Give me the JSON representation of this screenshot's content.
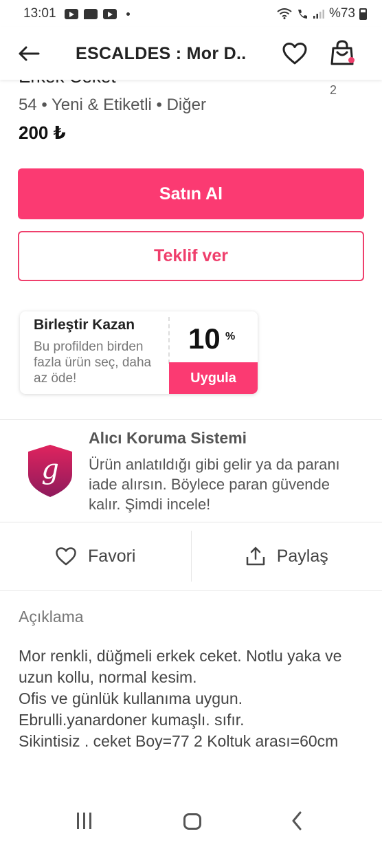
{
  "status_bar": {
    "time": "13:01",
    "battery": "%73"
  },
  "app_bar": {
    "title": "ESCALDES : Mor D..",
    "icons": [
      "arrow-left-icon",
      "heart-icon",
      "shopping-bag-icon"
    ]
  },
  "product": {
    "title": "Erkek Ceket",
    "photo_count": "2",
    "meta": "54 • Yeni & Etiketli • Diğer",
    "price": "200 ₺"
  },
  "buttons": {
    "buy": "Satın Al",
    "offer": "Teklif ver"
  },
  "bundle": {
    "title": "Birleştir Kazan",
    "description": "Bu profilden birden fazla ürün seç, daha az öde!",
    "percent": "10",
    "percent_symbol": "%",
    "apply": "Uygula"
  },
  "protection": {
    "logo_letter": "g",
    "title": "Alıcı Koruma Sistemi",
    "description": "Ürün anlatıldığı gibi gelir ya da paranı iade alırsın. Böylece paran güvende kalır. Şimdi incele!"
  },
  "actions": {
    "favorite": "Favori",
    "share": "Paylaş"
  },
  "description": {
    "label": "Açıklama",
    "text": "Mor renkli, düğmeli erkek ceket. Notlu yaka ve uzun kollu, normal kesim.\nOfis ve günlük kullanıma uygun.\nEbrulli.yanardoner kumaşlı. sıfır.\nSikintisiz . ceket Boy=77 2 Koltuk arası=60cm"
  },
  "colors": {
    "accent": "#fb3a72",
    "accent_border": "#ef3f6c",
    "shield_top": "#e0245e",
    "shield_bottom": "#8e1a5c"
  }
}
